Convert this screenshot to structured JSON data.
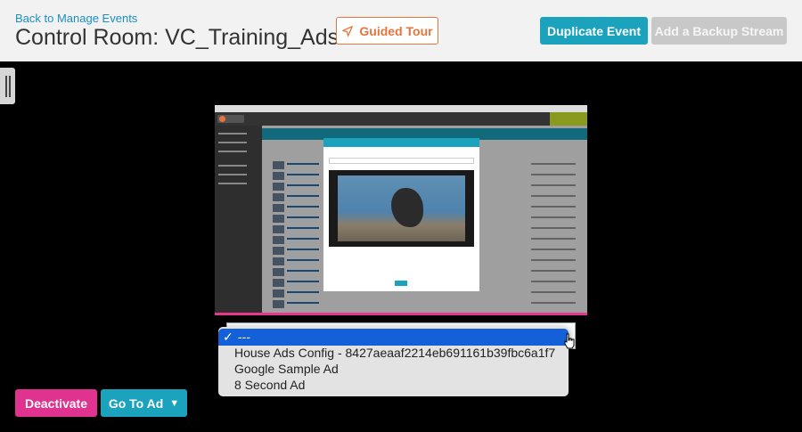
{
  "header": {
    "back_link": "Back to Manage Events",
    "title": "Control Room: VC_Training_Ads",
    "tour_label": "Guided Tour",
    "duplicate_label": "Duplicate Event",
    "backup_label": "Add a Backup Stream"
  },
  "ad_select": {
    "options": [
      "---",
      "House Ads Config - 8427aeaaf2214eb691161b39fbc6a1f7",
      "Google Sample Ad",
      "8 Second Ad"
    ],
    "selected_index": 0
  },
  "footer": {
    "deactivate_label": "Deactivate",
    "goto_label": "Go To Ad"
  },
  "colors": {
    "accent": "#1ba2bd",
    "deactivate": "#e0328f",
    "tour": "#e8743b",
    "selection": "#1360d8"
  },
  "icons": [
    "navigation-arrow-icon",
    "caret-down-icon",
    "checkmark-icon",
    "hand-cursor-icon",
    "drag-handle-icon"
  ]
}
